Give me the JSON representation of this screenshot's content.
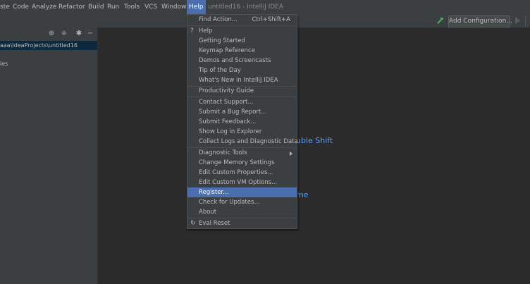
{
  "menubar": {
    "items": [
      {
        "label": "ste"
      },
      {
        "label": "Code"
      },
      {
        "label": "Analyze"
      },
      {
        "label": "Refactor"
      },
      {
        "label": "Build"
      },
      {
        "label": "Run"
      },
      {
        "label": "Tools"
      },
      {
        "label": "VCS"
      },
      {
        "label": "Window"
      },
      {
        "label": "Help"
      }
    ],
    "title": "untitled16 - IntelliJ IDEA"
  },
  "toolbar": {
    "add_configuration": "Add Configuration..."
  },
  "sidebar": {
    "path": "aaa\\IdeaProjects\\untitled16",
    "external": "les"
  },
  "editor": {
    "hint1": "uble Shift",
    "hint2": "me"
  },
  "help_menu": {
    "items": [
      {
        "label": "Find Action...",
        "shortcut": "Ctrl+Shift+A"
      },
      {
        "label": "Help",
        "prefix": "?"
      },
      {
        "label": "Getting Started"
      },
      {
        "label": "Keymap Reference"
      },
      {
        "label": "Demos and Screencasts"
      },
      {
        "label": "Tip of the Day"
      },
      {
        "label": "What's New in IntelliJ IDEA"
      },
      {
        "label": "Productivity Guide"
      },
      {
        "label": "Contact Support..."
      },
      {
        "label": "Submit a Bug Report..."
      },
      {
        "label": "Submit Feedback..."
      },
      {
        "label": "Show Log in Explorer"
      },
      {
        "label": "Collect Logs and Diagnostic Data"
      },
      {
        "label": "Diagnostic Tools",
        "submenu": true
      },
      {
        "label": "Change Memory Settings"
      },
      {
        "label": "Edit Custom Properties..."
      },
      {
        "label": "Edit Custom VM Options..."
      },
      {
        "label": "Register...",
        "selected": true
      },
      {
        "label": "Check for Updates..."
      },
      {
        "label": "About"
      },
      {
        "label": "Eval Reset",
        "prefix": "↻"
      }
    ]
  },
  "colors": {
    "accent": "#4b6eaf",
    "link": "#589df6",
    "background": "#2b2b2b",
    "panel": "#3c3f41"
  }
}
